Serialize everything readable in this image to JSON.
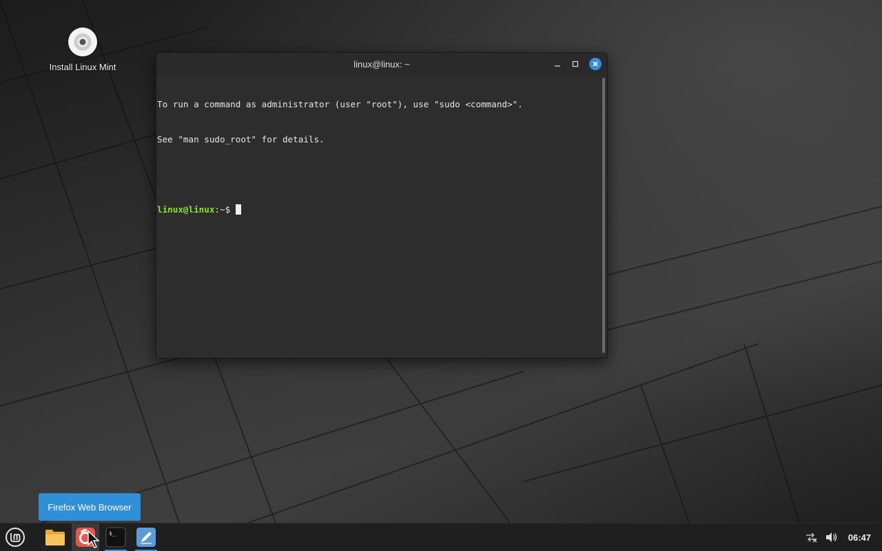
{
  "desktop": {
    "icons": [
      {
        "label": "Install Linux Mint",
        "icon": "disc-icon"
      }
    ]
  },
  "terminal_window": {
    "title": "linux@linux: ~",
    "lines": [
      "To run a command as administrator (user \"root\"), use \"sudo <command>\".",
      "See \"man sudo_root\" for details."
    ],
    "prompt_user": "linux@linux",
    "prompt_path": ":~$ ",
    "controls": {
      "minimize": "minimize-icon",
      "maximize": "maximize-icon",
      "close": "close-icon"
    }
  },
  "tooltip": {
    "text": "Firefox Web Browser"
  },
  "taskbar": {
    "menu_icon": "linux-mint-logo-icon",
    "launchers": [
      {
        "name": "Files",
        "icon": "folder-icon"
      },
      {
        "name": "Firefox Web Browser",
        "icon": "firefox-icon"
      },
      {
        "name": "Terminal",
        "icon": "terminal-icon",
        "active": true
      },
      {
        "name": "Text Editor",
        "icon": "text-editor-icon"
      }
    ],
    "tray": {
      "network_icon": "network-disconnected-icon",
      "volume_icon": "volume-icon",
      "clock": "06:47"
    }
  },
  "colors": {
    "accent": "#3a8cd6",
    "prompt_green": "#8ae234",
    "terminal_bg": "#2d2d2d",
    "tooltip_bg": "#2f8fd7"
  }
}
